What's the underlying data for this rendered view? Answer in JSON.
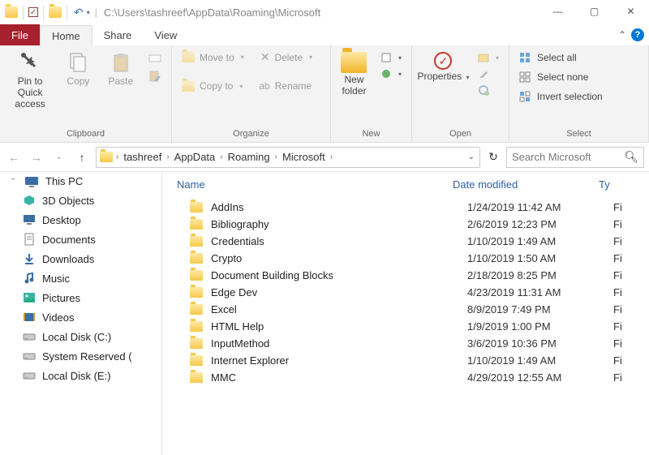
{
  "window": {
    "path": "C:\\Users\\tashreef\\AppData\\Roaming\\Microsoft",
    "win_min": "—",
    "win_max": "▢",
    "win_close": "✕"
  },
  "tabs": {
    "file": "File",
    "home": "Home",
    "share": "Share",
    "view": "View"
  },
  "ribbon": {
    "clipboard": {
      "label": "Clipboard",
      "pin": "Pin to Quick access",
      "copy": "Copy",
      "paste": "Paste"
    },
    "organize": {
      "label": "Organize",
      "moveto": "Move to",
      "copyto": "Copy to",
      "delete": "Delete",
      "rename": "Rename"
    },
    "new": {
      "label": "New",
      "newfolder": "New folder"
    },
    "open": {
      "label": "Open",
      "properties": "Properties"
    },
    "select": {
      "label": "Select",
      "selectall": "Select all",
      "selectnone": "Select none",
      "invert": "Invert selection"
    }
  },
  "breadcrumb": [
    "tashreef",
    "AppData",
    "Roaming",
    "Microsoft"
  ],
  "search": {
    "placeholder": "Search Microsoft"
  },
  "columns": {
    "name": "Name",
    "date": "Date modified",
    "type": "Ty"
  },
  "tree": {
    "root": "This PC",
    "items": [
      "3D Objects",
      "Desktop",
      "Documents",
      "Downloads",
      "Music",
      "Pictures",
      "Videos",
      "Local Disk (C:)",
      "System Reserved (",
      "Local Disk (E:)"
    ]
  },
  "files": [
    {
      "name": "AddIns",
      "date": "1/24/2019 11:42 AM",
      "type": "Fi"
    },
    {
      "name": "Bibliography",
      "date": "2/6/2019 12:23 PM",
      "type": "Fi"
    },
    {
      "name": "Credentials",
      "date": "1/10/2019 1:49 AM",
      "type": "Fi"
    },
    {
      "name": "Crypto",
      "date": "1/10/2019 1:50 AM",
      "type": "Fi"
    },
    {
      "name": "Document Building Blocks",
      "date": "2/18/2019 8:25 PM",
      "type": "Fi"
    },
    {
      "name": "Edge Dev",
      "date": "4/23/2019 11:31 AM",
      "type": "Fi"
    },
    {
      "name": "Excel",
      "date": "8/9/2019 7:49 PM",
      "type": "Fi"
    },
    {
      "name": "HTML Help",
      "date": "1/9/2019 1:00 PM",
      "type": "Fi"
    },
    {
      "name": "InputMethod",
      "date": "3/6/2019 10:36 PM",
      "type": "Fi"
    },
    {
      "name": "Internet Explorer",
      "date": "1/10/2019 1:49 AM",
      "type": "Fi"
    },
    {
      "name": "MMC",
      "date": "4/29/2019 12:55 AM",
      "type": "Fi"
    }
  ],
  "tree_icons": [
    "cube",
    "monitor",
    "document",
    "download",
    "music",
    "picture",
    "video",
    "disk",
    "disk",
    "disk"
  ]
}
